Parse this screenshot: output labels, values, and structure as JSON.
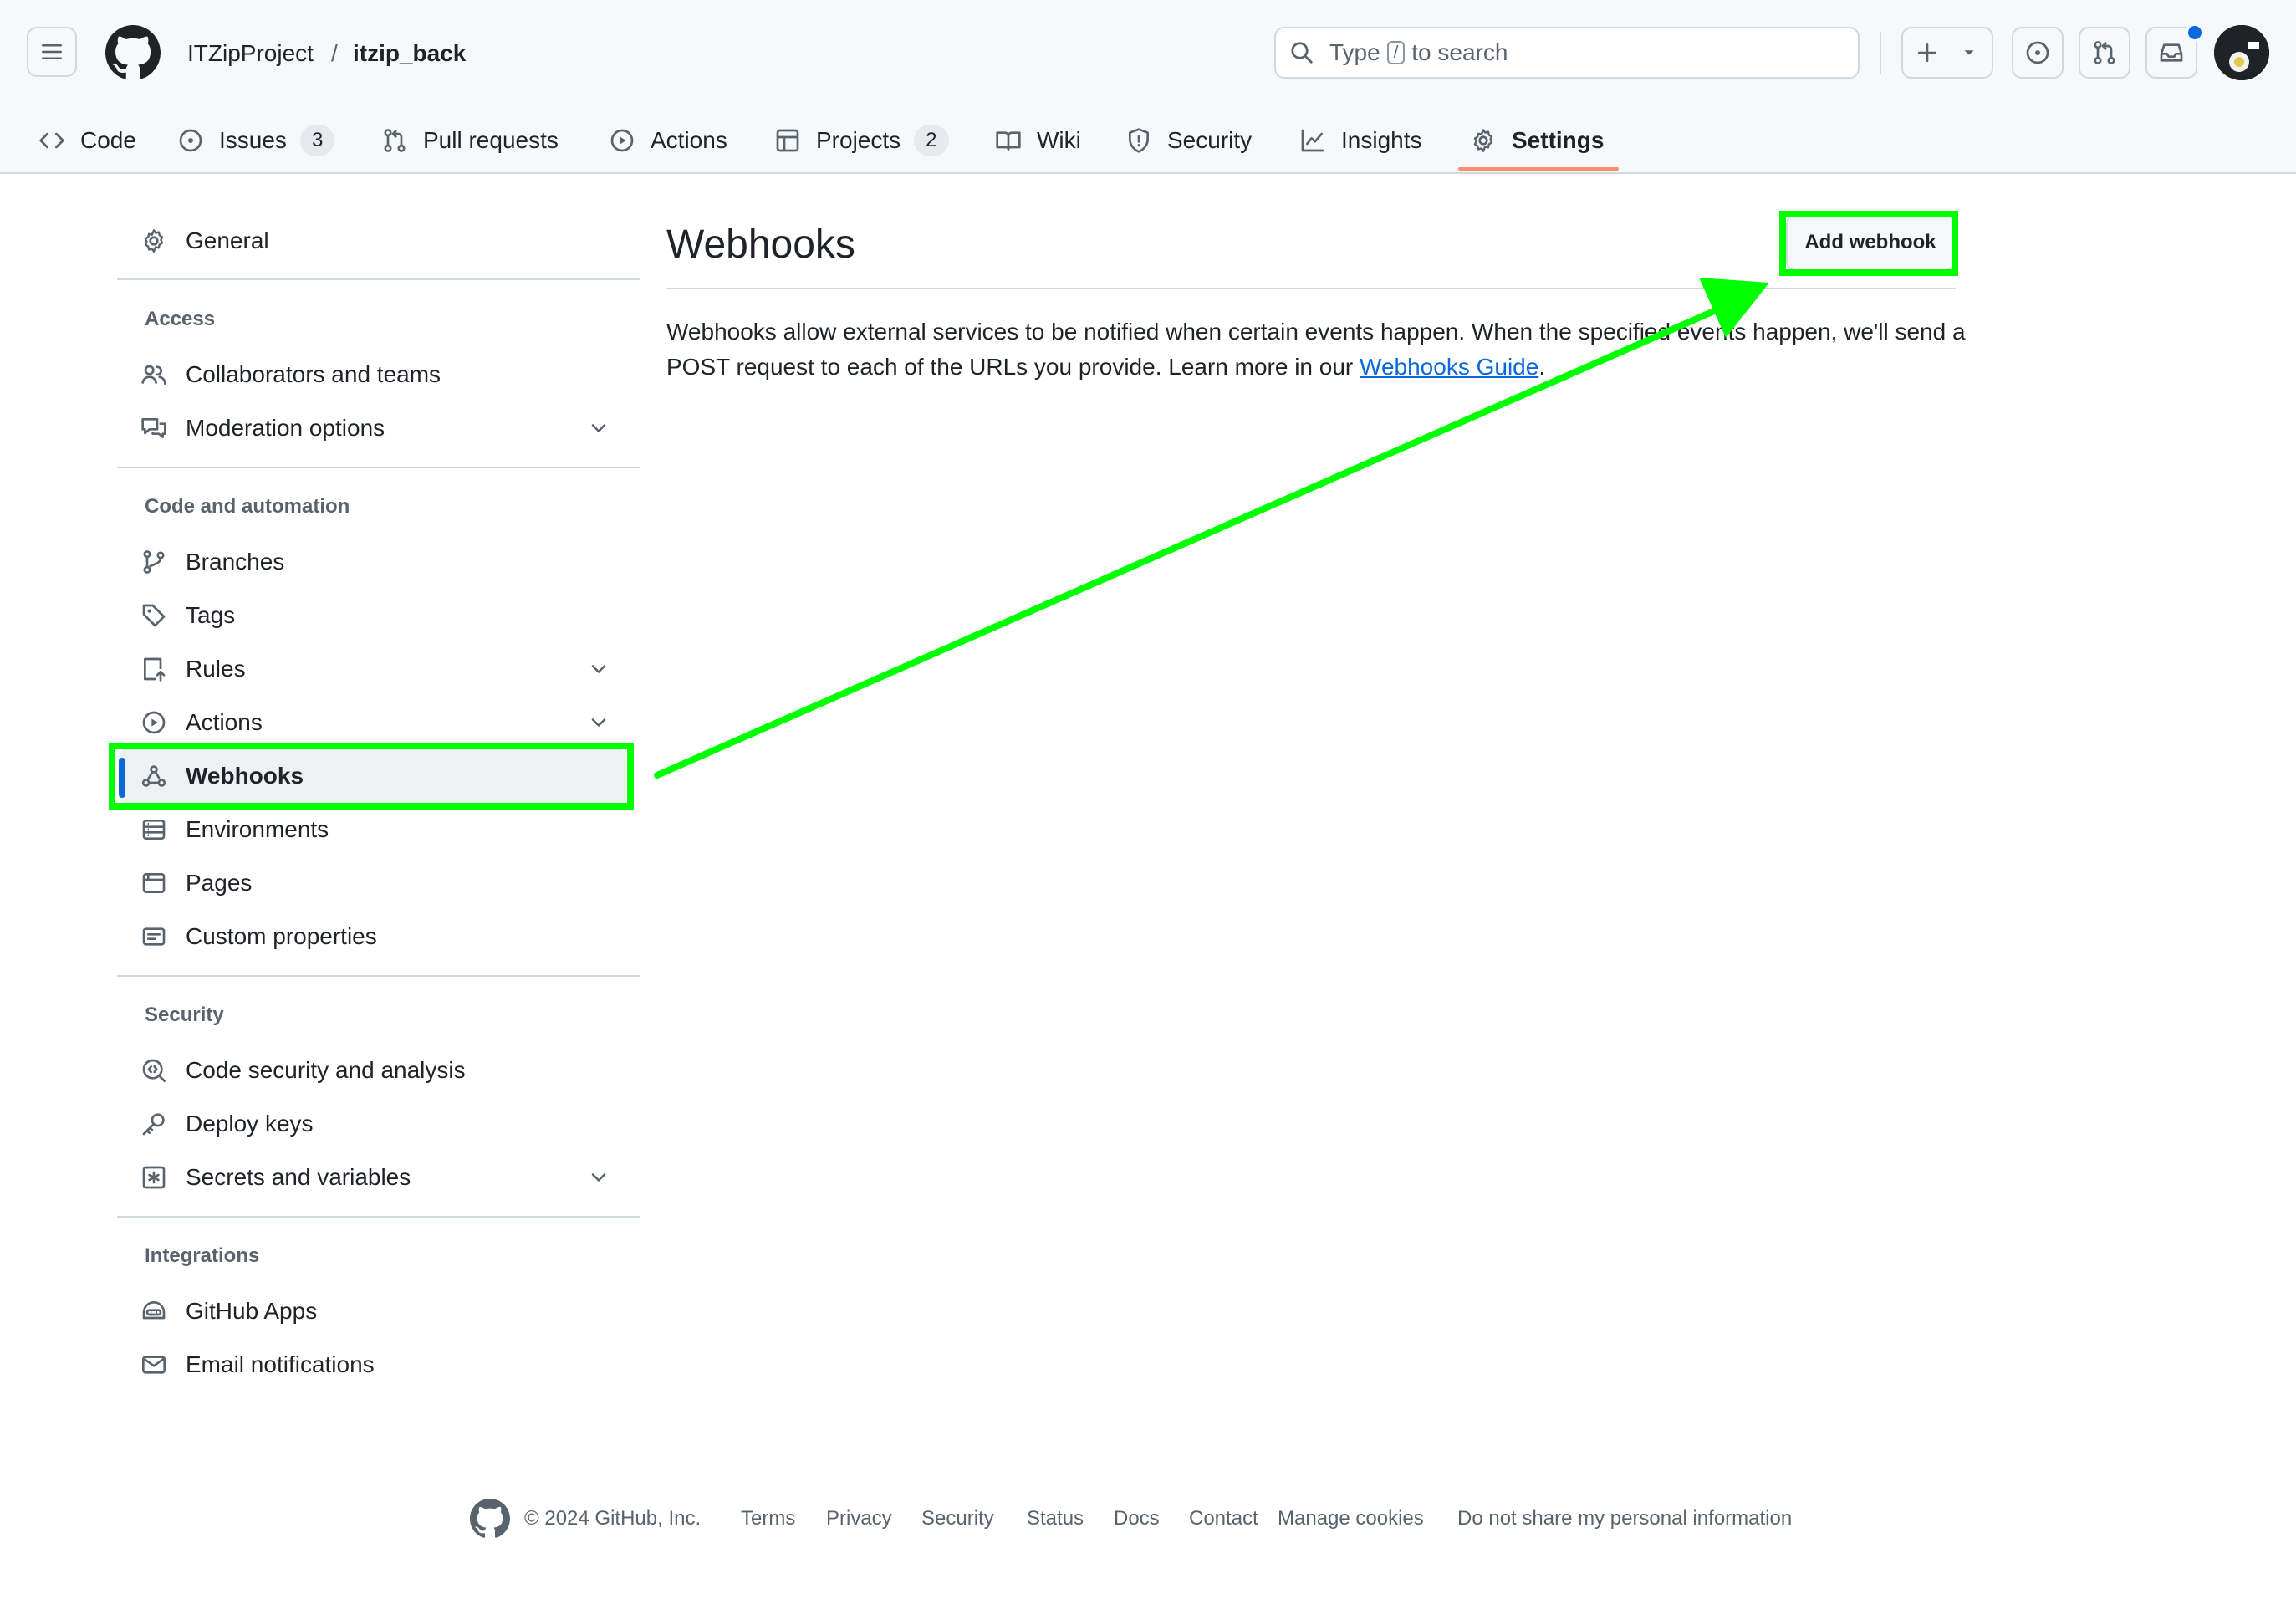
{
  "header": {
    "owner": "ITZipProject",
    "separator": "/",
    "repo": "itzip_back",
    "search": {
      "prefix": "Type",
      "key": "/",
      "suffix": "to search"
    }
  },
  "tabs": [
    {
      "label": "Code",
      "icon": "code-icon"
    },
    {
      "label": "Issues",
      "icon": "issue-icon",
      "count": "3"
    },
    {
      "label": "Pull requests",
      "icon": "pull-request-icon"
    },
    {
      "label": "Actions",
      "icon": "play-icon"
    },
    {
      "label": "Projects",
      "icon": "table-icon",
      "count": "2"
    },
    {
      "label": "Wiki",
      "icon": "book-icon"
    },
    {
      "label": "Security",
      "icon": "shield-icon"
    },
    {
      "label": "Insights",
      "icon": "graph-icon"
    },
    {
      "label": "Settings",
      "icon": "gear-icon",
      "active": true
    }
  ],
  "sidebar": {
    "general": "General",
    "sections": {
      "access": "Access",
      "code_automation": "Code and automation",
      "security": "Security",
      "integrations": "Integrations"
    },
    "items": {
      "collaborators": "Collaborators and teams",
      "moderation": "Moderation options",
      "branches": "Branches",
      "tags": "Tags",
      "rules": "Rules",
      "actions": "Actions",
      "webhooks": "Webhooks",
      "environments": "Environments",
      "pages": "Pages",
      "custom_properties": "Custom properties",
      "code_security": "Code security and analysis",
      "deploy_keys": "Deploy keys",
      "secrets": "Secrets and variables",
      "github_apps": "GitHub Apps",
      "email_notifications": "Email notifications"
    }
  },
  "main": {
    "title": "Webhooks",
    "add_button": "Add webhook",
    "description": "Webhooks allow external services to be notified when certain events happen. When the specified events happen, we'll send a POST request to each of the URLs you provide. Learn more in our",
    "link": "Webhooks Guide",
    "description_end": "."
  },
  "footer": {
    "copyright": "© 2024 GitHub, Inc.",
    "links": [
      "Terms",
      "Privacy",
      "Security",
      "Status",
      "Docs",
      "Contact",
      "Manage cookies",
      "Do not share my personal information"
    ]
  },
  "annotation": {
    "color": "#00ff00"
  }
}
